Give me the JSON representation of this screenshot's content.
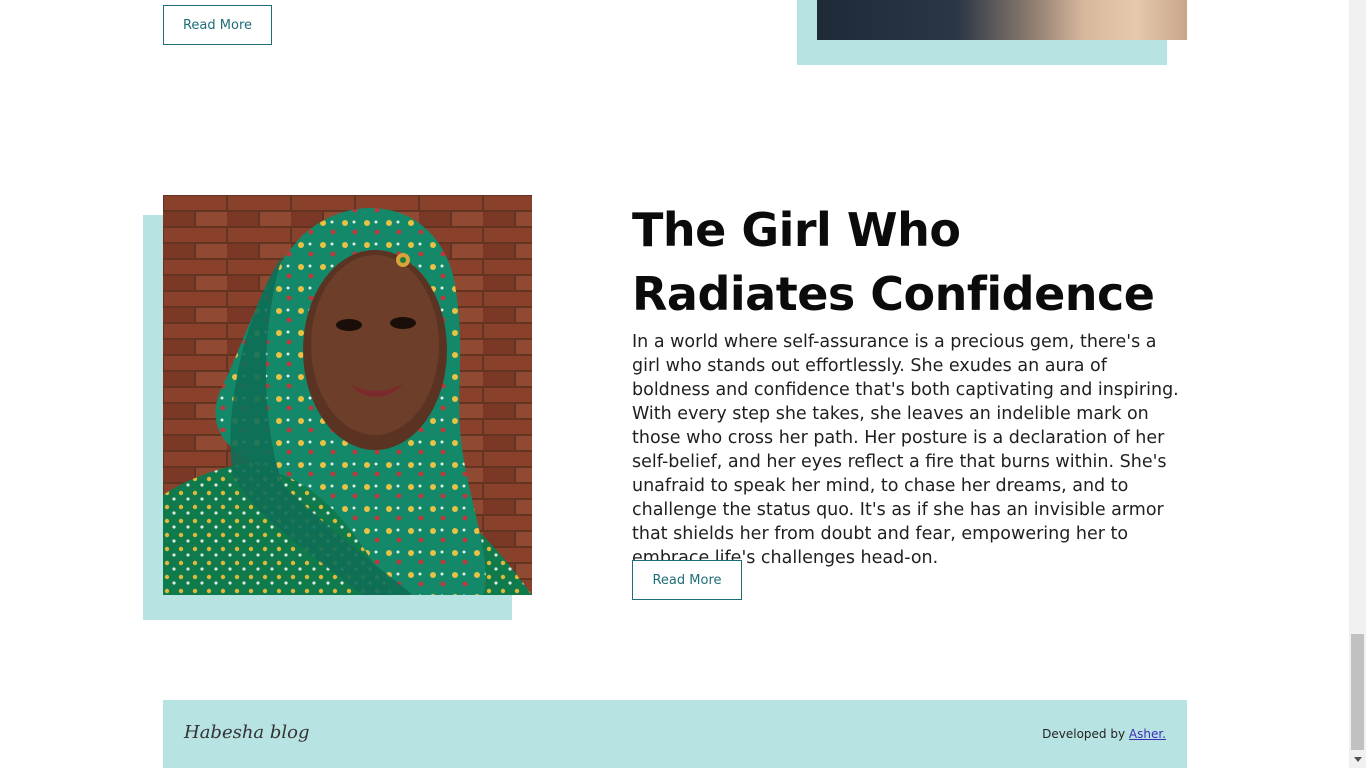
{
  "top_post": {
    "read_more_label": "Read More"
  },
  "featured_post": {
    "title": "The Girl Who Radiates Confidence",
    "body": "In a world where self-assurance is a precious gem, there's a girl who stands out effortlessly. She exudes an aura of boldness and confidence that's both captivating and inspiring. With every step she takes, she leaves an indelible mark on those who cross her path. Her posture is a declaration of her self-belief, and her eyes reflect a fire that burns within. She's unafraid to speak her mind, to chase her dreams, and to challenge the status quo. It's as if she has an invisible armor that shields her from doubt and fear, empowering her to embrace life's challenges head-on.",
    "read_more_label": "Read More"
  },
  "footer": {
    "brand": "Habesha blog",
    "credit_prefix": "Developed by",
    "credit_link": "Asher."
  },
  "colors": {
    "accent": "#b8e3e3",
    "button_border": "#1f6d78",
    "link": "#3b2db5"
  }
}
